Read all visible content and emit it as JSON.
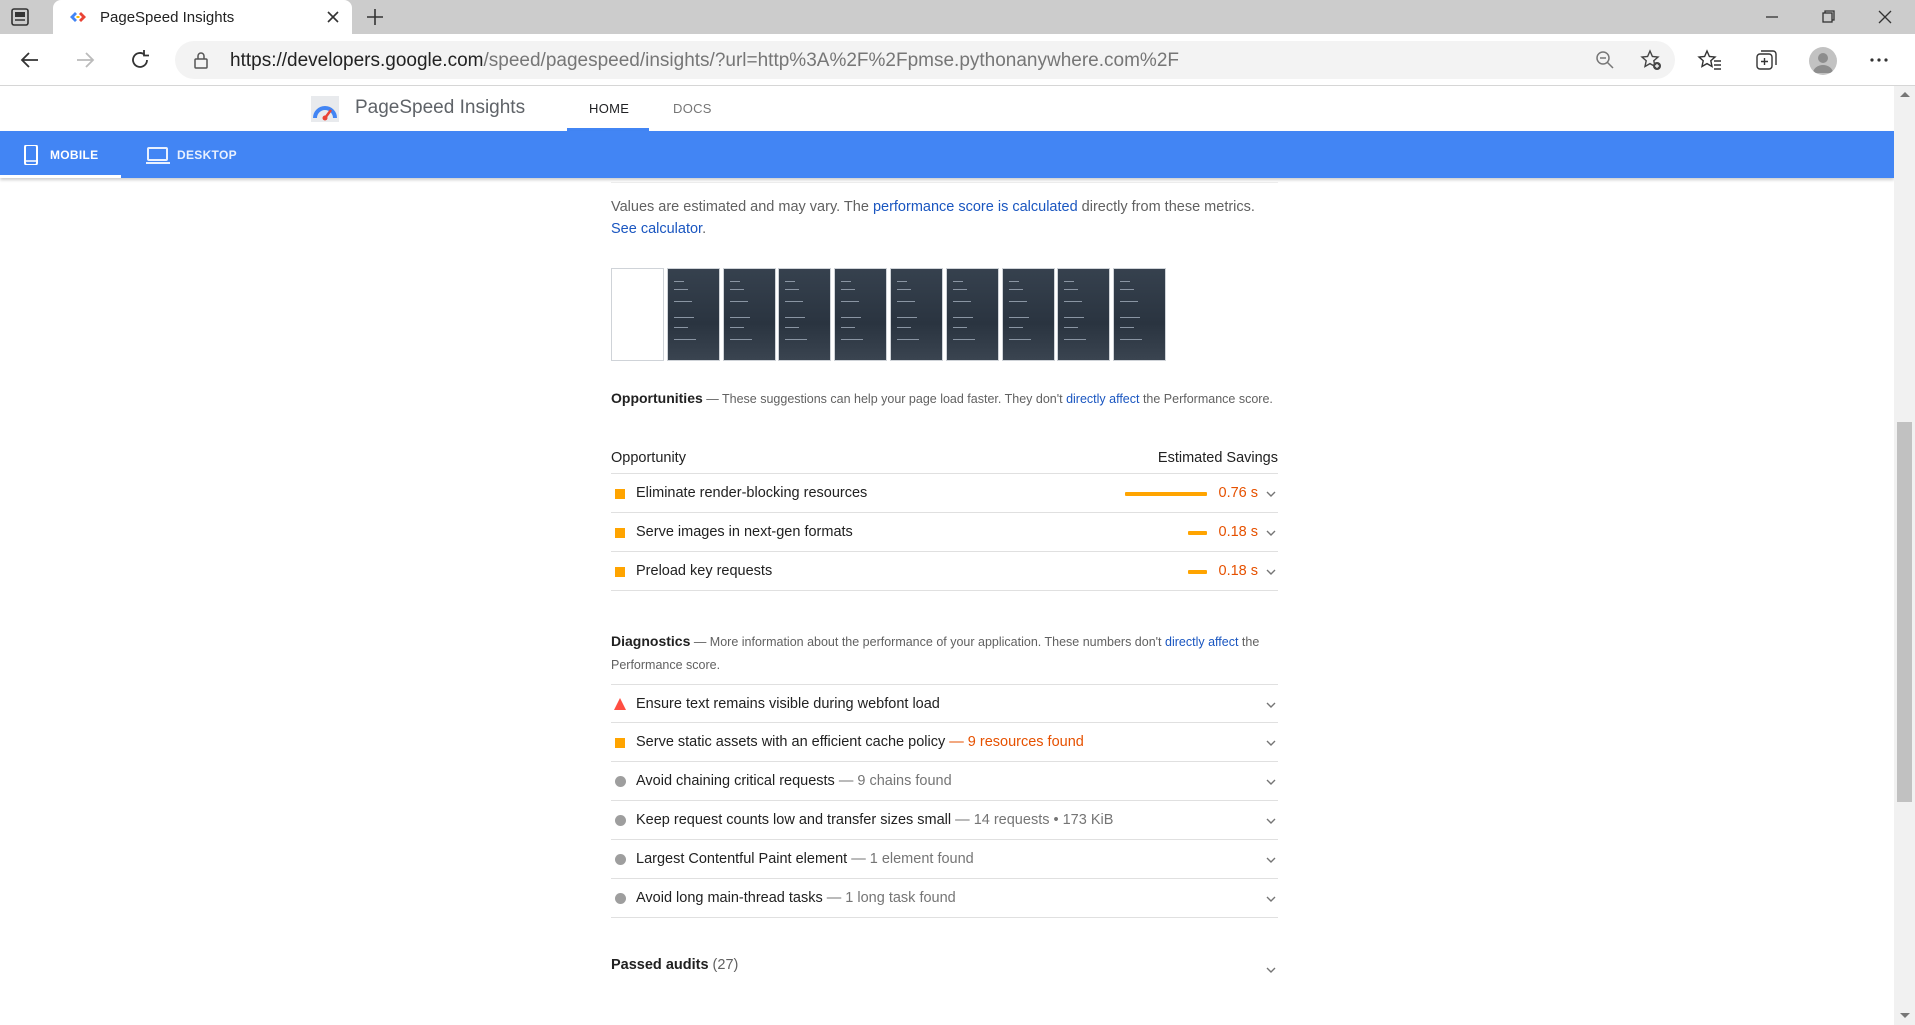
{
  "browser": {
    "tab_title": "PageSpeed Insights",
    "url_host": "https://developers.google.com",
    "url_path": "/speed/pagespeed/insights/?url=http%3A%2F%2Fpmse.pythonanywhere.com%2F"
  },
  "header": {
    "title": "PageSpeed Insights",
    "nav_home": "HOME",
    "nav_docs": "DOCS"
  },
  "devices": {
    "mobile": "MOBILE",
    "desktop": "DESKTOP"
  },
  "note": {
    "text1": "Values are estimated and may vary. The ",
    "link1": "performance score is calculated",
    "text2": " directly from these metrics. ",
    "link2": "See calculator",
    "text3": "."
  },
  "filmstrip_frames": 10,
  "opportunities": {
    "title": "Opportunities",
    "desc1": " — These suggestions can help your page load faster. They don't ",
    "link": "directly affect",
    "desc2": " the Performance score.",
    "col_left": "Opportunity",
    "col_right": "Estimated Savings",
    "items": [
      {
        "label": "Eliminate render-blocking resources",
        "savings": "0.76 s",
        "savings_seconds": 0.76
      },
      {
        "label": "Serve images in next-gen formats",
        "savings": "0.18 s",
        "savings_seconds": 0.18
      },
      {
        "label": "Preload key requests",
        "savings": "0.18 s",
        "savings_seconds": 0.18
      }
    ]
  },
  "diagnostics": {
    "title": "Diagnostics",
    "desc1": " — More information about the performance of your application. These numbers don't ",
    "link": "directly affect",
    "desc2": " the Performance score.",
    "items": [
      {
        "label": "Ensure text remains visible during webfont load",
        "extra": "",
        "severity": "fail"
      },
      {
        "label": "Serve static assets with an efficient cache policy",
        "extra": " — 9 resources found",
        "severity": "average"
      },
      {
        "label": "Avoid chaining critical requests",
        "extra": " — 9 chains found",
        "severity": "info"
      },
      {
        "label": "Keep request counts low and transfer sizes small",
        "extra": " — 14 requests • 173 KiB",
        "severity": "info"
      },
      {
        "label": "Largest Contentful Paint element",
        "extra": " — 1 element found",
        "severity": "info"
      },
      {
        "label": "Avoid long main-thread tasks",
        "extra": " — 1 long task found",
        "severity": "info"
      }
    ]
  },
  "passed": {
    "label": "Passed audits",
    "count": "(27)"
  },
  "colors": {
    "brand_blue": "#4285f4",
    "average": "#ffa400",
    "fail": "#ff4e42",
    "link": "#1a56c0"
  }
}
